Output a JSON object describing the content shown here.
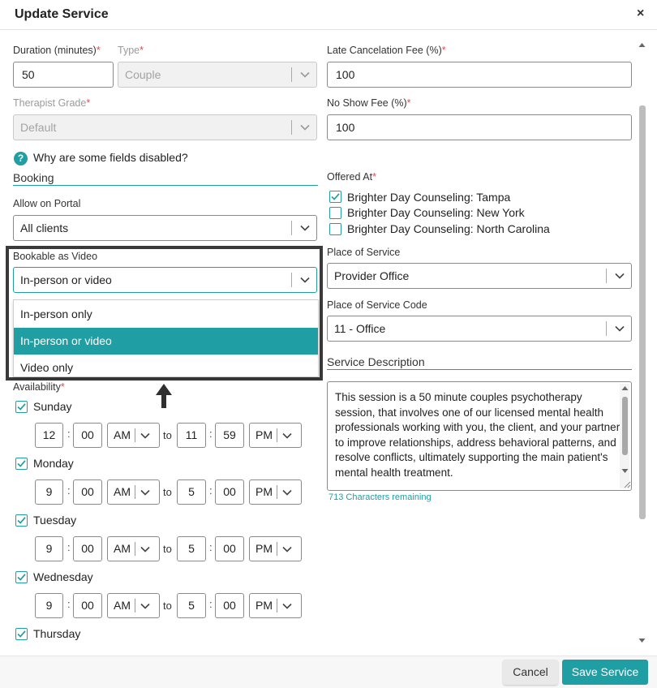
{
  "dialog": {
    "title": "Update Service",
    "close_glyph": "×"
  },
  "fields": {
    "duration": {
      "label": "Duration (minutes)",
      "value": "50"
    },
    "type": {
      "label": "Type",
      "value": "Couple"
    },
    "late_fee": {
      "label": "Late Cancelation Fee (%)",
      "value": "100"
    },
    "therapist_grade": {
      "label": "Therapist Grade",
      "value": "Default"
    },
    "no_show_fee": {
      "label": "No Show Fee (%)",
      "value": "100"
    }
  },
  "required_mark": "*",
  "help": {
    "icon": "?",
    "text": "Why are some fields disabled?"
  },
  "booking": {
    "heading": "Booking",
    "allow_portal_label": "Allow on Portal",
    "allow_portal_value": "All clients",
    "bookable_label": "Bookable as Video",
    "bookable_value": "In-person or video",
    "options": [
      "In-person only",
      "In-person or video",
      "Video only"
    ]
  },
  "offered_at": {
    "label": "Offered At",
    "locations": [
      "Brighter Day Counseling: Tampa",
      "Brighter Day Counseling: New York",
      "Brighter Day Counseling: North Carolina"
    ],
    "checked": [
      true,
      false,
      false
    ]
  },
  "place_of_service": {
    "label": "Place of Service",
    "value": "Provider Office"
  },
  "place_of_service_code": {
    "label": "Place of Service Code",
    "value": "11 - Office"
  },
  "service_description": {
    "heading": "Service Description",
    "text": "This session is a 50 minute couples psychotherapy session, that involves one of our licensed mental health professionals working with you, the client, and your partner to improve relationships, address behavioral patterns, and resolve conflicts, ultimately supporting the main patient's mental health treatment.",
    "remaining": "713 Characters remaining"
  },
  "availability": {
    "label": "Availability",
    "to_text": "to",
    "colon": ":",
    "days": [
      {
        "name": "Sunday",
        "from_h": "12",
        "from_m": "00",
        "from_ap": "AM",
        "to_h": "11",
        "to_m": "59",
        "to_ap": "PM"
      },
      {
        "name": "Monday",
        "from_h": "9",
        "from_m": "00",
        "from_ap": "AM",
        "to_h": "5",
        "to_m": "00",
        "to_ap": "PM"
      },
      {
        "name": "Tuesday",
        "from_h": "9",
        "from_m": "00",
        "from_ap": "AM",
        "to_h": "5",
        "to_m": "00",
        "to_ap": "PM"
      },
      {
        "name": "Wednesday",
        "from_h": "9",
        "from_m": "00",
        "from_ap": "AM",
        "to_h": "5",
        "to_m": "00",
        "to_ap": "PM"
      },
      {
        "name": "Thursday"
      }
    ]
  },
  "footer": {
    "cancel": "Cancel",
    "save": "Save Service"
  },
  "colors": {
    "accent": "#1f9ea3",
    "highlight_border": "#3a3a3a"
  }
}
